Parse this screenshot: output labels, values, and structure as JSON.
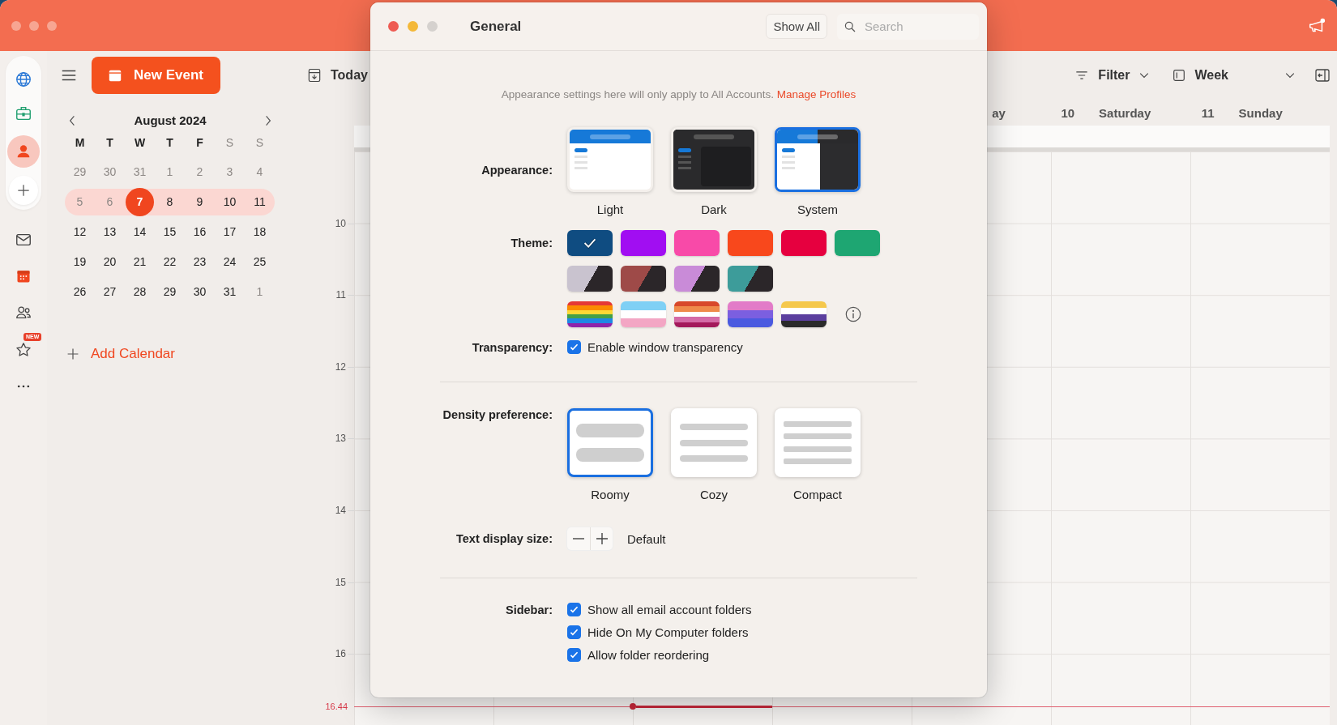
{
  "app": {
    "rail": {
      "badge": "NEW"
    },
    "toolbar": {
      "new_event": "New Event",
      "today": "Today",
      "filter": "Filter",
      "view": "Week"
    },
    "mini_calendar": {
      "title": "August 2024",
      "weekdays": [
        {
          "label": "M",
          "muted": false
        },
        {
          "label": "T",
          "muted": false
        },
        {
          "label": "W",
          "muted": false
        },
        {
          "label": "T",
          "muted": false
        },
        {
          "label": "F",
          "muted": false
        },
        {
          "label": "S",
          "muted": true
        },
        {
          "label": "S",
          "muted": true
        }
      ],
      "weeks": [
        {
          "selected": false,
          "days": [
            {
              "label": "29",
              "muted": true,
              "today": false
            },
            {
              "label": "30",
              "muted": true,
              "today": false
            },
            {
              "label": "31",
              "muted": true,
              "today": false
            },
            {
              "label": "1",
              "muted": true,
              "today": false
            },
            {
              "label": "2",
              "muted": true,
              "today": false
            },
            {
              "label": "3",
              "muted": true,
              "today": false
            },
            {
              "label": "4",
              "muted": true,
              "today": false
            }
          ]
        },
        {
          "selected": true,
          "days": [
            {
              "label": "5",
              "muted": true,
              "today": false
            },
            {
              "label": "6",
              "muted": true,
              "today": false
            },
            {
              "label": "7",
              "muted": false,
              "today": true
            },
            {
              "label": "8",
              "muted": false,
              "today": false
            },
            {
              "label": "9",
              "muted": false,
              "today": false
            },
            {
              "label": "10",
              "muted": false,
              "today": false
            },
            {
              "label": "11",
              "muted": false,
              "today": false
            }
          ]
        },
        {
          "selected": false,
          "days": [
            {
              "label": "12",
              "muted": false,
              "today": false
            },
            {
              "label": "13",
              "muted": false,
              "today": false
            },
            {
              "label": "14",
              "muted": false,
              "today": false
            },
            {
              "label": "15",
              "muted": false,
              "today": false
            },
            {
              "label": "16",
              "muted": false,
              "today": false
            },
            {
              "label": "17",
              "muted": false,
              "today": false
            },
            {
              "label": "18",
              "muted": false,
              "today": false
            }
          ]
        },
        {
          "selected": false,
          "days": [
            {
              "label": "19",
              "muted": false,
              "today": false
            },
            {
              "label": "20",
              "muted": false,
              "today": false
            },
            {
              "label": "21",
              "muted": false,
              "today": false
            },
            {
              "label": "22",
              "muted": false,
              "today": false
            },
            {
              "label": "23",
              "muted": false,
              "today": false
            },
            {
              "label": "24",
              "muted": false,
              "today": false
            },
            {
              "label": "25",
              "muted": false,
              "today": false
            }
          ]
        },
        {
          "selected": false,
          "days": [
            {
              "label": "26",
              "muted": false,
              "today": false
            },
            {
              "label": "27",
              "muted": false,
              "today": false
            },
            {
              "label": "28",
              "muted": false,
              "today": false
            },
            {
              "label": "29",
              "muted": false,
              "today": false
            },
            {
              "label": "30",
              "muted": false,
              "today": false
            },
            {
              "label": "31",
              "muted": false,
              "today": false
            },
            {
              "label": "1",
              "muted": true,
              "today": false
            }
          ]
        }
      ]
    },
    "add_calendar": "Add Calendar",
    "day_headers": [
      {
        "day": "ay"
      },
      {
        "date": "10",
        "day": "Saturday"
      },
      {
        "date": "11",
        "day": "Sunday"
      }
    ],
    "hours": [
      "10",
      "11",
      "12",
      "13",
      "14",
      "15",
      "16"
    ],
    "now": "16.44"
  },
  "dialog": {
    "title": "General",
    "show_all": "Show All",
    "search": {
      "placeholder": "Search"
    },
    "notice": "Appearance settings here will only apply to All Accounts.",
    "notice_link": "Manage Profiles",
    "appearance": {
      "label": "Appearance:",
      "options": [
        {
          "kind": "light",
          "label": "Light",
          "selected": false
        },
        {
          "kind": "dark",
          "label": "Dark",
          "selected": false
        },
        {
          "kind": "system",
          "label": "System",
          "selected": true
        }
      ]
    },
    "theme": {
      "label": "Theme:",
      "rows": [
        [
          {
            "kind": "solid",
            "color": "#0f4c81",
            "selected": true
          },
          {
            "kind": "solid",
            "color": "#a10ef2",
            "selected": false
          },
          {
            "kind": "solid",
            "color": "#f84aa8",
            "selected": false
          },
          {
            "kind": "solid",
            "color": "#f8481c",
            "selected": false
          },
          {
            "kind": "solid",
            "color": "#e6003f",
            "selected": false
          },
          {
            "kind": "solid",
            "color": "#1ea672",
            "selected": false
          }
        ],
        [
          {
            "kind": "photo",
            "color": "#c9c3cf",
            "selected": false
          },
          {
            "kind": "photo",
            "color": "#9e4a48",
            "selected": false
          },
          {
            "kind": "photo",
            "color": "#c98bd8",
            "selected": false
          },
          {
            "kind": "photo",
            "color": "#3d9c9a",
            "selected": false
          }
        ],
        [
          {
            "kind": "stripes",
            "stripes": [
              {
                "color": "#e53935"
              },
              {
                "color": "#fb8c00"
              },
              {
                "color": "#fdd835"
              },
              {
                "color": "#43a047"
              },
              {
                "color": "#1e88e5"
              },
              {
                "color": "#8e24aa"
              }
            ],
            "selected": false
          },
          {
            "kind": "stripes",
            "stripes": [
              {
                "color": "#7fd0f5"
              },
              {
                "color": "#ffffff"
              },
              {
                "color": "#f3a6c4"
              }
            ],
            "selected": false
          },
          {
            "kind": "stripes",
            "stripes": [
              {
                "color": "#d8482a"
              },
              {
                "color": "#ef8a4a"
              },
              {
                "color": "#ffffff"
              },
              {
                "color": "#d46aa6"
              },
              {
                "color": "#a3195b"
              }
            ],
            "selected": false
          },
          {
            "kind": "stripes",
            "stripes": [
              {
                "color": "#e27bc8"
              },
              {
                "color": "#7b5fe0"
              },
              {
                "color": "#4a5ae0"
              }
            ],
            "selected": false
          },
          {
            "kind": "stripes",
            "stripes": [
              {
                "color": "#f5c84c"
              },
              {
                "color": "#ffffff"
              },
              {
                "color": "#5b3f9e"
              },
              {
                "color": "#2a2a2a"
              }
            ],
            "selected": false
          }
        ]
      ]
    },
    "transparency": {
      "label": "Transparency:",
      "option": {
        "label": "Enable window transparency",
        "checked": true
      }
    },
    "density": {
      "label": "Density preference:",
      "options": [
        {
          "kind": "roomy",
          "label": "Roomy",
          "selected": true
        },
        {
          "kind": "cozy",
          "label": "Cozy",
          "selected": false
        },
        {
          "kind": "compact",
          "label": "Compact",
          "selected": false
        }
      ]
    },
    "text_size": {
      "label": "Text display size:",
      "value": "Default"
    },
    "sidebar": {
      "label": "Sidebar:",
      "options": [
        {
          "label": "Show all email account folders",
          "checked": true
        },
        {
          "label": "Hide On My Computer folders",
          "checked": true
        },
        {
          "label": "Allow folder reordering",
          "checked": true
        }
      ]
    }
  }
}
